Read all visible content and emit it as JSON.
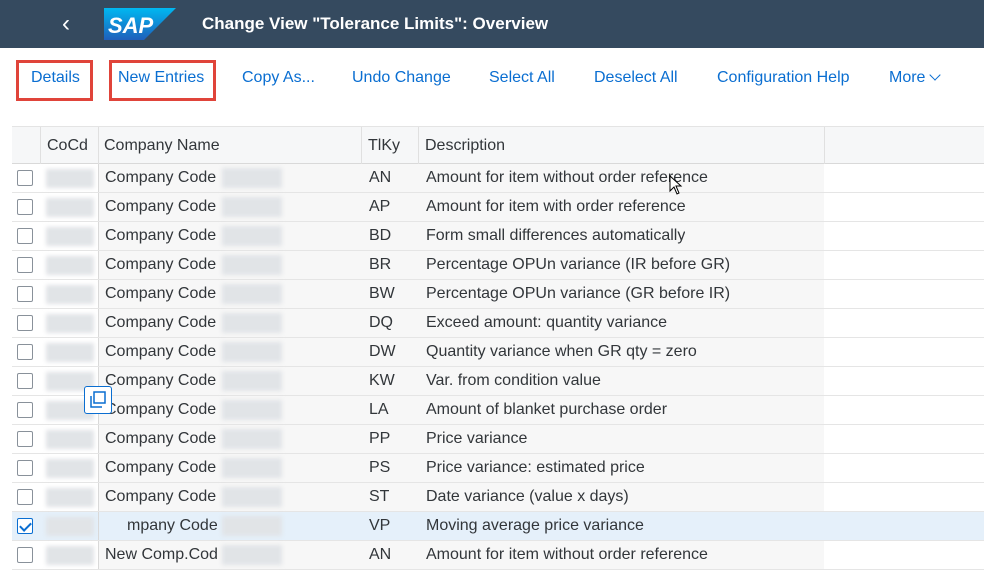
{
  "shell": {
    "back_label": "‹",
    "logo_text": "SAP",
    "title": "Change View \"Tolerance Limits\": Overview",
    "colors": {
      "shell": "#354a5f",
      "accent": "#0a6ed1",
      "highlight": "#e0443a"
    }
  },
  "toolbar": {
    "details": "Details",
    "new_entries": "New Entries",
    "copy_as": "Copy As...",
    "undo_change": "Undo Change",
    "select_all": "Select All",
    "deselect_all": "Deselect All",
    "configuration_help": "Configuration Help",
    "more": "More"
  },
  "table": {
    "headers": {
      "cocd": "CoCd",
      "company_name": "Company Name",
      "tlky": "TlKy",
      "description": "Description"
    },
    "rows": [
      {
        "company": "Company Code",
        "key": "AN",
        "desc": "Amount for item without order reference",
        "checked": false
      },
      {
        "company": "Company Code",
        "key": "AP",
        "desc": "Amount for item with order reference",
        "checked": false
      },
      {
        "company": "Company Code",
        "key": "BD",
        "desc": "Form small differences automatically",
        "checked": false
      },
      {
        "company": "Company Code",
        "key": "BR",
        "desc": "Percentage OPUn variance (IR before GR)",
        "checked": false
      },
      {
        "company": "Company Code",
        "key": "BW",
        "desc": "Percentage OPUn variance (GR before IR)",
        "checked": false
      },
      {
        "company": "Company Code",
        "key": "DQ",
        "desc": "Exceed amount: quantity variance",
        "checked": false
      },
      {
        "company": "Company Code",
        "key": "DW",
        "desc": "Quantity variance when GR qty = zero",
        "checked": false
      },
      {
        "company": "Company Code",
        "key": "KW",
        "desc": "Var. from condition value",
        "checked": false
      },
      {
        "company": "Company Code",
        "key": "LA",
        "desc": "Amount of blanket purchase order",
        "checked": false
      },
      {
        "company": "Company Code",
        "key": "PP",
        "desc": "Price variance",
        "checked": false
      },
      {
        "company": "Company Code",
        "key": "PS",
        "desc": "Price variance: estimated price",
        "checked": false
      },
      {
        "company": "Company Code",
        "key": "ST",
        "desc": "Date variance (value x days)",
        "checked": false
      },
      {
        "company": "mpany Code",
        "key": "VP",
        "desc": "Moving average price variance",
        "checked": true
      },
      {
        "company": "New Comp.Code",
        "key": "AN",
        "desc": "Amount for item without order reference",
        "checked": false
      }
    ]
  }
}
